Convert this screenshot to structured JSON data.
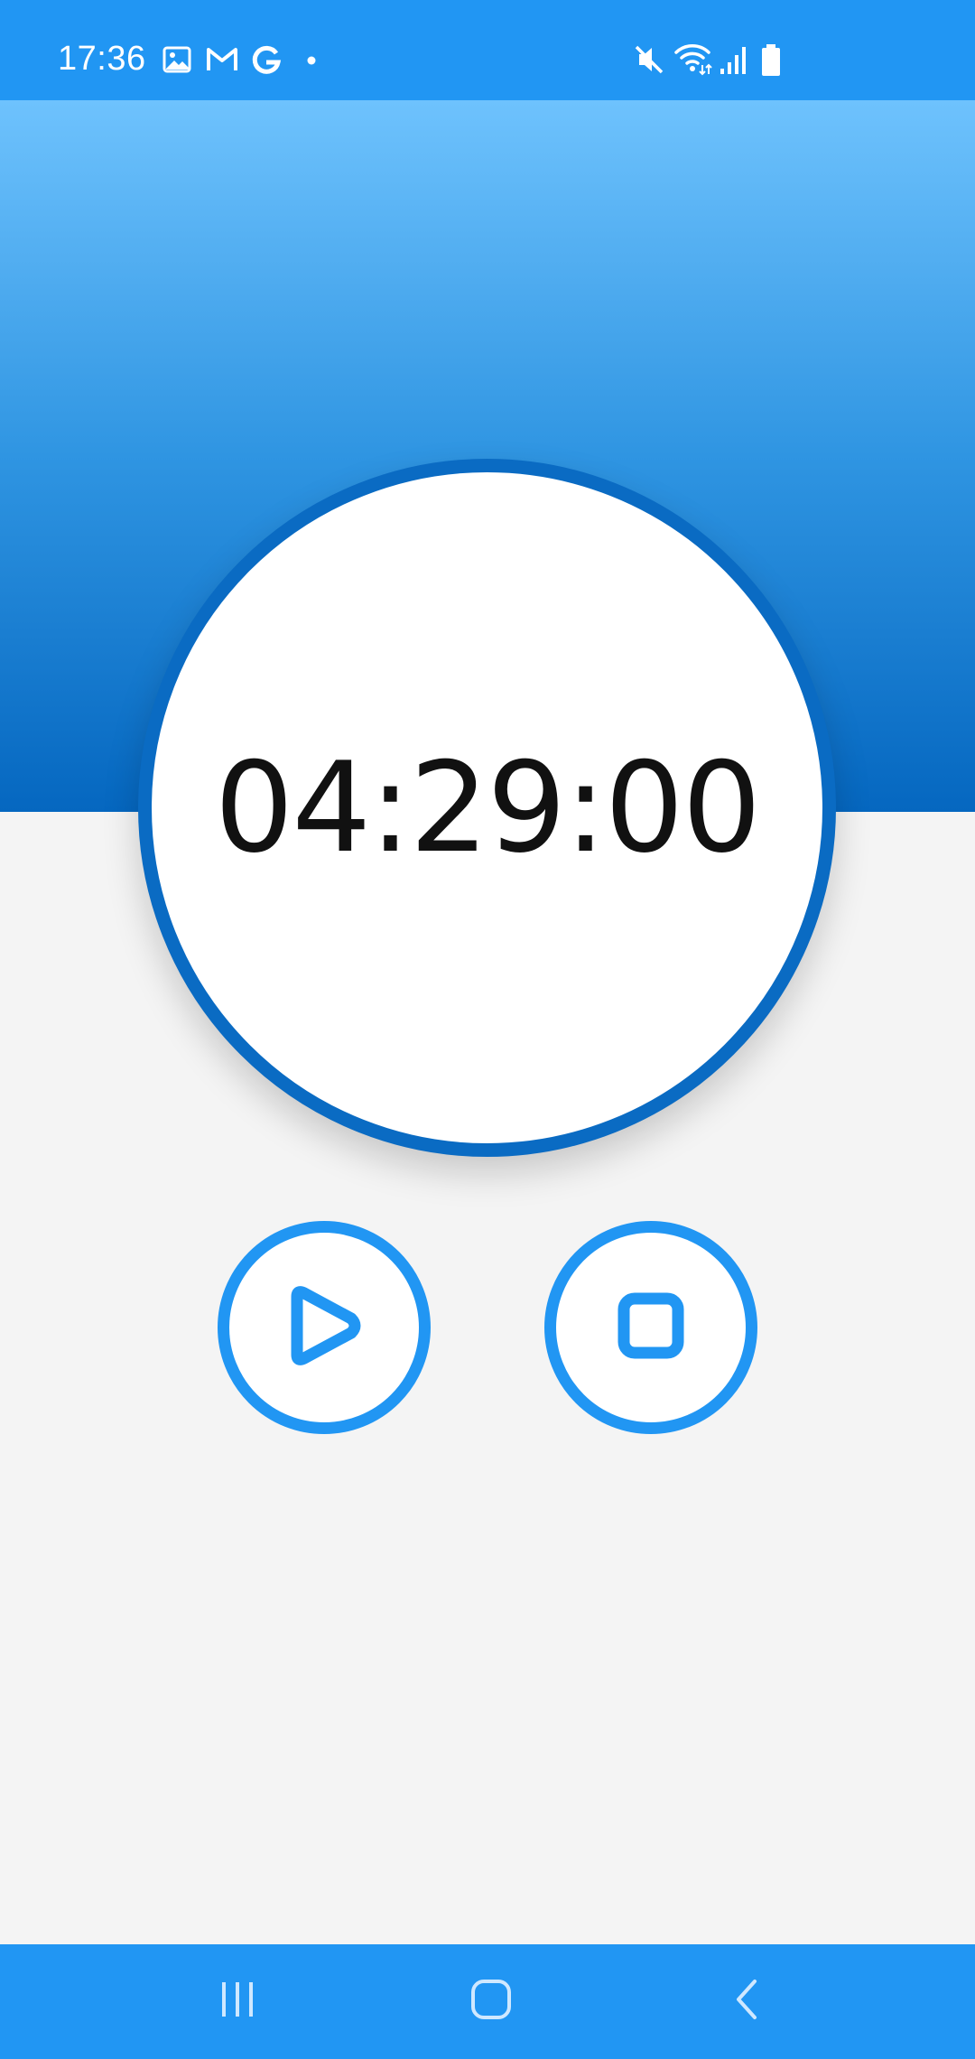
{
  "status_bar": {
    "time": "17:36",
    "left_icons": [
      "gallery-icon",
      "gmail-icon",
      "google-icon",
      "notification-dot-icon"
    ],
    "right_icons": [
      "mute-icon",
      "wifi-icon",
      "signal-icon",
      "battery-icon"
    ]
  },
  "timer": {
    "display": "04:29:00"
  },
  "controls": {
    "play_icon": "play-icon",
    "stop_icon": "stop-icon"
  },
  "nav": {
    "recents_icon": "recents-icon",
    "home_icon": "home-icon",
    "back_icon": "back-icon"
  },
  "colors": {
    "status_bar": "#2196f3",
    "gradient_top": "#6ec2fd",
    "gradient_bottom": "#0567c0",
    "ring": "#0a6bc3",
    "accent": "#2196f3",
    "background": "#f4f4f4"
  }
}
